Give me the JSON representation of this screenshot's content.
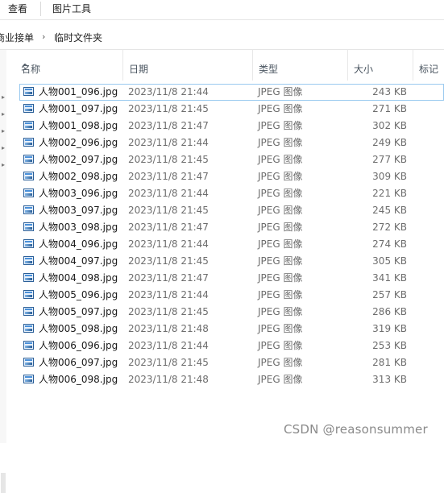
{
  "ribbon": {
    "tabs": [
      "查看",
      "图片工具"
    ]
  },
  "breadcrumb": {
    "items": [
      "商业接单",
      "临时文件夹"
    ],
    "separator": "›"
  },
  "columns": {
    "name": "名称",
    "date": "日期",
    "type": "类型",
    "size": "大小",
    "tags": "标记"
  },
  "sort": {
    "column": "name",
    "direction": "ascending"
  },
  "files": [
    {
      "name": "人物001_096.jpg",
      "date": "2023/11/8 21:44",
      "type": "JPEG 图像",
      "size": "243 KB",
      "selected": true
    },
    {
      "name": "人物001_097.jpg",
      "date": "2023/11/8 21:45",
      "type": "JPEG 图像",
      "size": "271 KB"
    },
    {
      "name": "人物001_098.jpg",
      "date": "2023/11/8 21:47",
      "type": "JPEG 图像",
      "size": "302 KB"
    },
    {
      "name": "人物002_096.jpg",
      "date": "2023/11/8 21:44",
      "type": "JPEG 图像",
      "size": "249 KB"
    },
    {
      "name": "人物002_097.jpg",
      "date": "2023/11/8 21:45",
      "type": "JPEG 图像",
      "size": "277 KB"
    },
    {
      "name": "人物002_098.jpg",
      "date": "2023/11/8 21:47",
      "type": "JPEG 图像",
      "size": "309 KB"
    },
    {
      "name": "人物003_096.jpg",
      "date": "2023/11/8 21:44",
      "type": "JPEG 图像",
      "size": "221 KB"
    },
    {
      "name": "人物003_097.jpg",
      "date": "2023/11/8 21:45",
      "type": "JPEG 图像",
      "size": "245 KB"
    },
    {
      "name": "人物003_098.jpg",
      "date": "2023/11/8 21:47",
      "type": "JPEG 图像",
      "size": "272 KB"
    },
    {
      "name": "人物004_096.jpg",
      "date": "2023/11/8 21:44",
      "type": "JPEG 图像",
      "size": "274 KB"
    },
    {
      "name": "人物004_097.jpg",
      "date": "2023/11/8 21:45",
      "type": "JPEG 图像",
      "size": "305 KB"
    },
    {
      "name": "人物004_098.jpg",
      "date": "2023/11/8 21:47",
      "type": "JPEG 图像",
      "size": "341 KB"
    },
    {
      "name": "人物005_096.jpg",
      "date": "2023/11/8 21:44",
      "type": "JPEG 图像",
      "size": "257 KB"
    },
    {
      "name": "人物005_097.jpg",
      "date": "2023/11/8 21:45",
      "type": "JPEG 图像",
      "size": "286 KB"
    },
    {
      "name": "人物005_098.jpg",
      "date": "2023/11/8 21:48",
      "type": "JPEG 图像",
      "size": "319 KB"
    },
    {
      "name": "人物006_096.jpg",
      "date": "2023/11/8 21:44",
      "type": "JPEG 图像",
      "size": "253 KB"
    },
    {
      "name": "人物006_097.jpg",
      "date": "2023/11/8 21:45",
      "type": "JPEG 图像",
      "size": "281 KB"
    },
    {
      "name": "人物006_098.jpg",
      "date": "2023/11/8 21:48",
      "type": "JPEG 图像",
      "size": "313 KB"
    }
  ],
  "watermark": "CSDN @reasonsummer",
  "colors": {
    "selection_border": "#99c9ef",
    "icon_blue": "#2b5f98",
    "header_text": "#4a5560"
  }
}
